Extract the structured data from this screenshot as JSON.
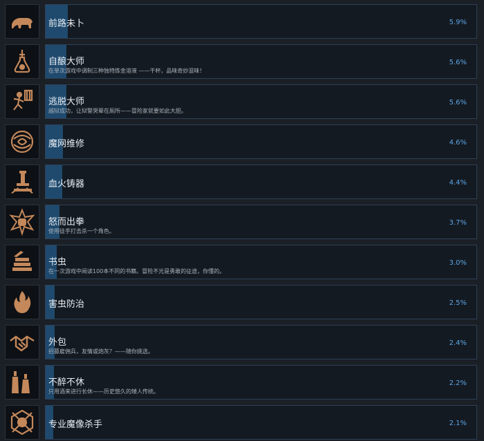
{
  "colors": {
    "panel_border": "#2c4057",
    "progress_fill": "#1f4a6e",
    "percent_text": "#5aa5e6",
    "icon_bronze": "#c4885a"
  },
  "achievements": [
    {
      "title": "前路未卜",
      "desc": "",
      "percent": "5.9%",
      "unlock_fraction": 0.059,
      "icon": "bear-icon"
    },
    {
      "title": "自酿大师",
      "desc": "在单次游戏中调制三种独特炼金溶液 ——干杯，品味奇妙滋味！",
      "percent": "5.6%",
      "unlock_fraction": 0.056,
      "icon": "flask-icon"
    },
    {
      "title": "逃脱大师",
      "desc": "越狱成功，让狱警哭晕在厕所——冒险家就要如此大胆。",
      "percent": "5.6%",
      "unlock_fraction": 0.056,
      "icon": "escape-icon"
    },
    {
      "title": "魔网维修",
      "desc": "",
      "percent": "4.6%",
      "unlock_fraction": 0.046,
      "icon": "weave-icon"
    },
    {
      "title": "血火铸器",
      "desc": "",
      "percent": "4.4%",
      "unlock_fraction": 0.044,
      "icon": "forge-icon"
    },
    {
      "title": "怒而出拳",
      "desc": "使用徒手打击杀一个角色。",
      "percent": "3.7%",
      "unlock_fraction": 0.037,
      "icon": "fist-icon"
    },
    {
      "title": "书虫",
      "desc": "在一次游戏中阅读100本不同的书籍。冒险不光是勇敢的征途，你懂的。",
      "percent": "3.0%",
      "unlock_fraction": 0.03,
      "icon": "books-icon"
    },
    {
      "title": "害虫防治",
      "desc": "",
      "percent": "2.5%",
      "unlock_fraction": 0.025,
      "icon": "fire-icon"
    },
    {
      "title": "外包",
      "desc": "招募雇佣兵，友情或炮灰？——随你挑选。",
      "percent": "2.4%",
      "unlock_fraction": 0.024,
      "icon": "handshake-icon"
    },
    {
      "title": "不醉不休",
      "desc": "只用酒来进行长休——历史悠久的矮人传统。",
      "percent": "2.2%",
      "unlock_fraction": 0.022,
      "icon": "bottles-icon"
    },
    {
      "title": "专业魔像杀手",
      "desc": "",
      "percent": "2.1%",
      "unlock_fraction": 0.021,
      "icon": "golem-icon"
    }
  ]
}
